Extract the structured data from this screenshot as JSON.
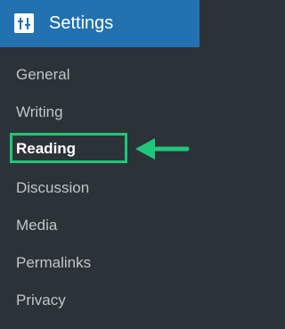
{
  "header": {
    "title": "Settings",
    "icon": "settings-sliders-icon",
    "background": "#2271b1"
  },
  "menu": {
    "items": [
      {
        "label": "General"
      },
      {
        "label": "Writing"
      },
      {
        "label": "Reading",
        "active": true
      },
      {
        "label": "Discussion"
      },
      {
        "label": "Media"
      },
      {
        "label": "Permalinks"
      },
      {
        "label": "Privacy"
      }
    ],
    "text_color": "#c3c4c7",
    "active_color": "#ffffff"
  },
  "annotation": {
    "highlight_color": "#1fc77a",
    "arrow_icon": "arrow-left-icon"
  }
}
